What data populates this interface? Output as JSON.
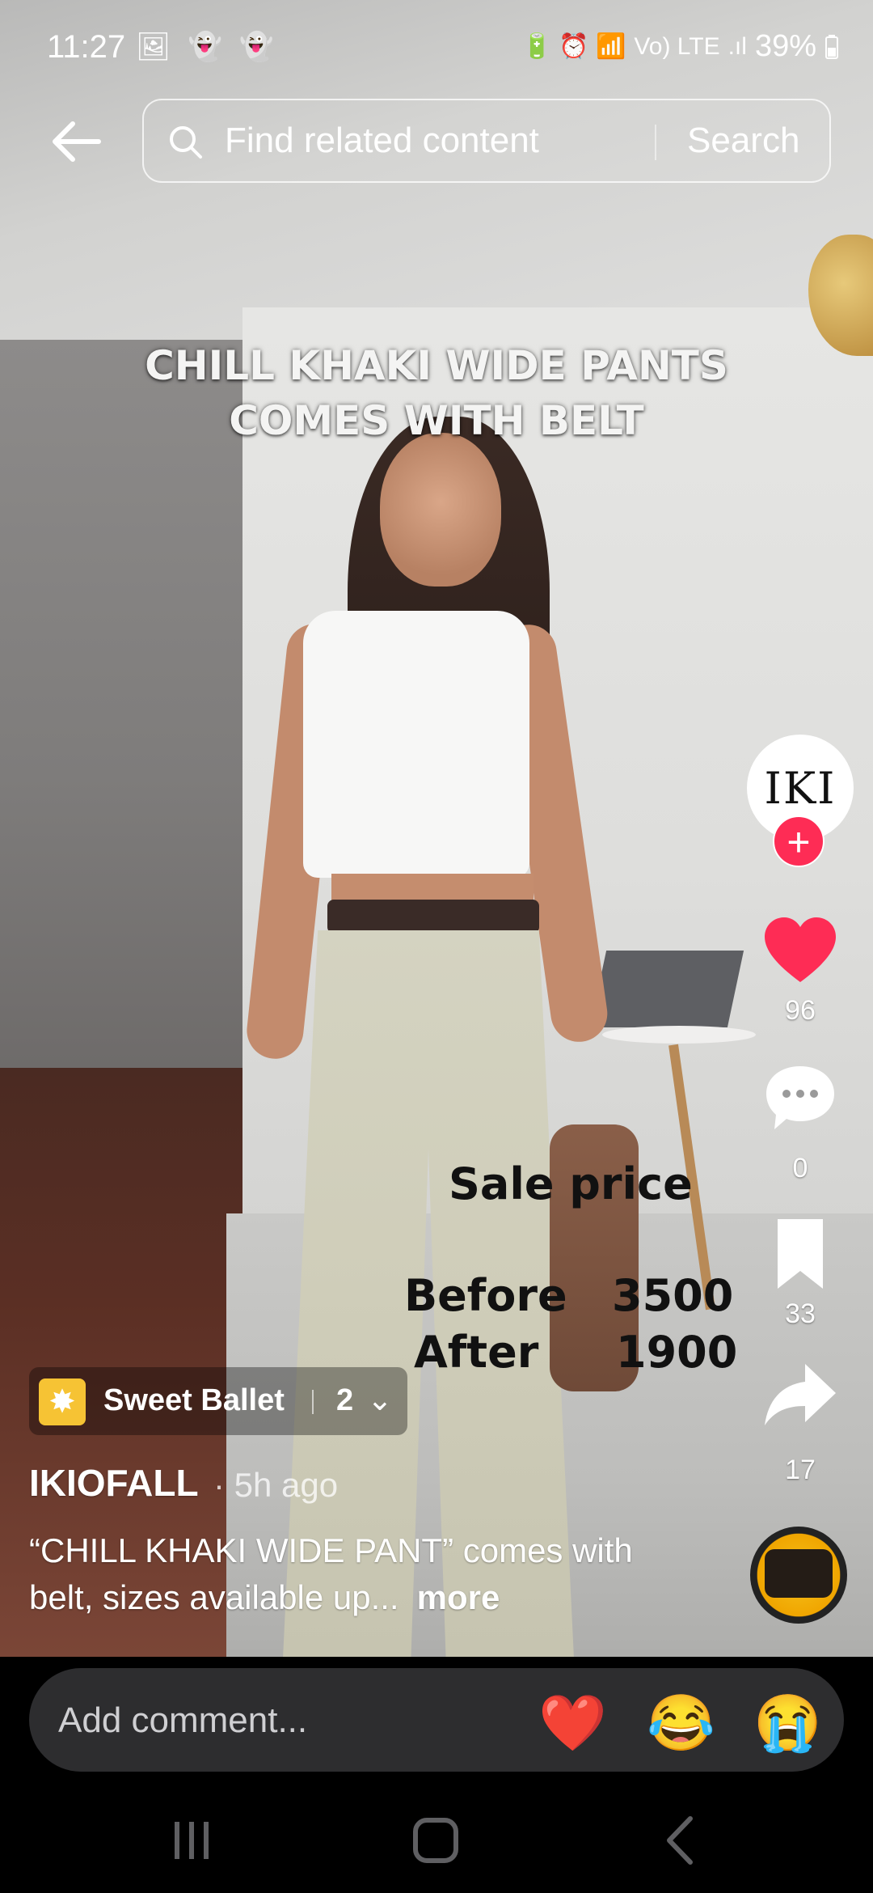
{
  "status_bar": {
    "time": "11:27",
    "left_icons": "🖼 👻 👻",
    "right_icons": "🔋 ⏰ 📶",
    "network": "Vo) LTE",
    "signal": ".ıl",
    "battery": "39%"
  },
  "header": {
    "back_icon": "arrow-left-icon",
    "search_placeholder": "Find related content",
    "search_button": "Search"
  },
  "video": {
    "overlay_title_line1": "CHILL KHAKI WIDE PANTS",
    "overlay_title_line2": "COMES WITH BELT",
    "sale_title": "Sale price",
    "before_label": "Before",
    "before_value": "3500",
    "after_label": "After",
    "after_value": "1900"
  },
  "right_rail": {
    "avatar_text": "IKI",
    "follow_symbol": "+",
    "likes": "96",
    "comments": "0",
    "saves": "33",
    "shares": "17"
  },
  "sound": {
    "name": "Sweet Ballet",
    "count": "2"
  },
  "post": {
    "author": "IKIOFALL",
    "time_ago": "· 5h ago",
    "caption": "“CHILL KHAKI WIDE PANT” comes with belt, sizes available up...",
    "more": "more"
  },
  "comment_bar": {
    "placeholder": "Add comment...",
    "emojis": [
      "❤️",
      "😂",
      "😭"
    ]
  },
  "colors": {
    "like_red": "#fe2c55",
    "comment_bar_bg": "#2d2d2f"
  }
}
